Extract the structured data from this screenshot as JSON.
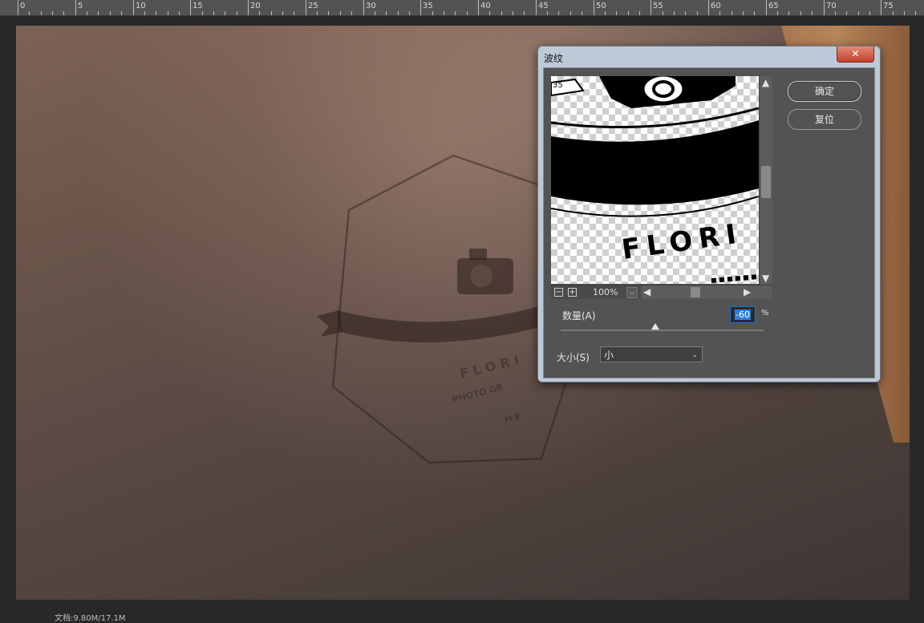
{
  "ruler": {
    "labels": [
      "0",
      "5",
      "10",
      "15",
      "20",
      "25",
      "30",
      "35",
      "40",
      "45",
      "50",
      "55",
      "60",
      "65",
      "70",
      "75"
    ]
  },
  "status": {
    "doc_info": "文档:9.80M/17.1M"
  },
  "dialog": {
    "title": "波纹",
    "close_glyph": "✕",
    "ok_label": "确定",
    "reset_label": "复位",
    "preview_text": "FLORI",
    "zoom_level": "100%",
    "amount_label": "数量(A)",
    "amount_value": "-60",
    "amount_unit": "%",
    "size_label": "大小(S)",
    "size_value": "小"
  }
}
